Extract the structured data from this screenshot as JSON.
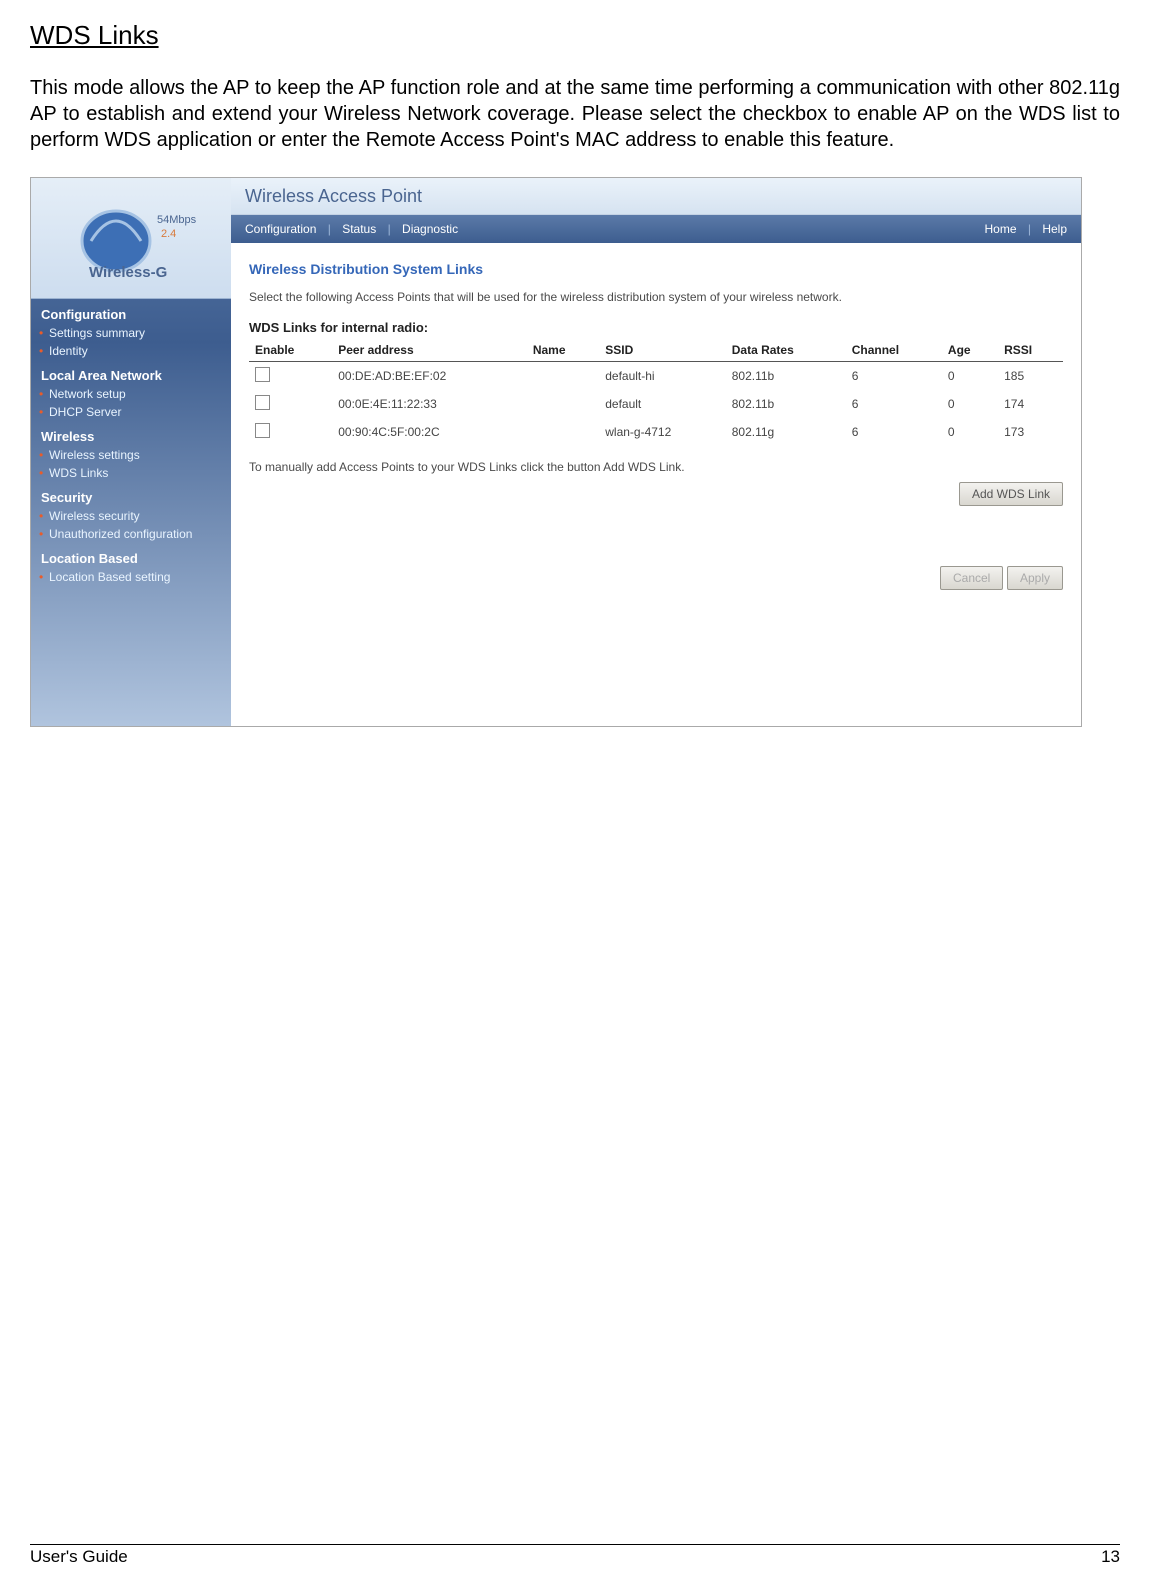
{
  "doc": {
    "title": "WDS Links",
    "paragraph": "This mode allows the AP to keep the AP function role and at the same time performing a communication with other 802.11g AP to establish and extend your Wireless Network coverage. Please select the checkbox to enable AP on the WDS list to perform WDS application or enter the Remote Access Point's MAC address to enable this feature."
  },
  "logo": {
    "mbps": "54Mbps",
    "ghz": "2.4",
    "label": "Wireless-G"
  },
  "sidebar": {
    "configuration_title": "Configuration",
    "settings_summary": "Settings summary",
    "identity": "Identity",
    "lan_title": "Local Area Network",
    "network_setup": "Network setup",
    "dhcp_server": "DHCP Server",
    "wireless_title": "Wireless",
    "wireless_settings": "Wireless settings",
    "wds_links": "WDS Links",
    "security_title": "Security",
    "wireless_security": "Wireless security",
    "unauthorized_configuration": "Unauthorized configuration",
    "location_title": "Location Based",
    "location_setting": "Location Based setting"
  },
  "topbar": {
    "title": "Wireless Access Point"
  },
  "menubar": {
    "configuration": "Configuration",
    "status": "Status",
    "diagnostic": "Diagnostic",
    "home": "Home",
    "help": "Help"
  },
  "panel": {
    "title": "Wireless Distribution System Links",
    "intro": "Select the following Access Points that will be used for the wireless distribution system of your wireless network.",
    "subhead": "WDS Links for internal radio:",
    "manual_note": "To manually add Access Points to your WDS Links click the button Add WDS Link.",
    "add_btn": "Add WDS Link",
    "cancel_btn": "Cancel",
    "apply_btn": "Apply"
  },
  "table": {
    "headers": {
      "enable": "Enable",
      "peer": "Peer address",
      "name": "Name",
      "ssid": "SSID",
      "rates": "Data Rates",
      "channel": "Channel",
      "age": "Age",
      "rssi": "RSSI"
    },
    "rows": [
      {
        "peer": "00:DE:AD:BE:EF:02",
        "name": "",
        "ssid": "default-hi",
        "rates": "802.11b",
        "channel": "6",
        "age": "0",
        "rssi": "185"
      },
      {
        "peer": "00:0E:4E:11:22:33",
        "name": "",
        "ssid": "default",
        "rates": "802.11b",
        "channel": "6",
        "age": "0",
        "rssi": "174"
      },
      {
        "peer": "00:90:4C:5F:00:2C",
        "name": "",
        "ssid": "wlan-g-4712",
        "rates": "802.11g",
        "channel": "6",
        "age": "0",
        "rssi": "173"
      }
    ]
  },
  "footer": {
    "left": "User's Guide",
    "right": "13"
  }
}
